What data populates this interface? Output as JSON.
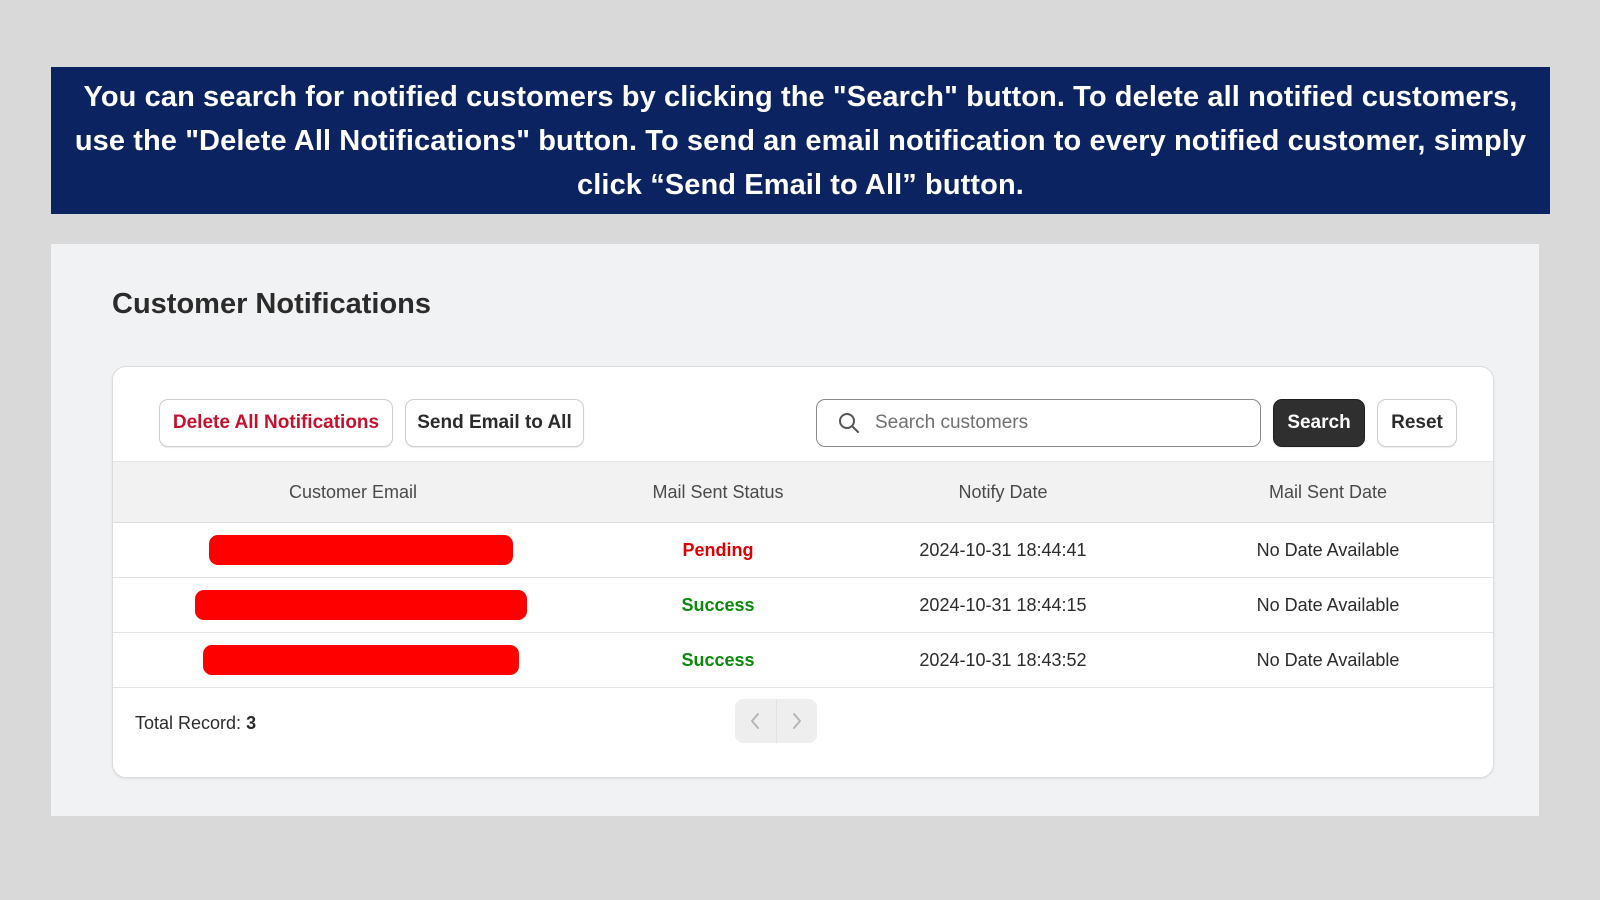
{
  "banner": {
    "text": "You can search for notified customers by clicking the \"Search\" button. To delete all notified customers, use the \"Delete All Notifications\" button. To send an email notification to every notified customer, simply click “Send Email to All” button."
  },
  "page": {
    "title": "Customer Notifications"
  },
  "toolbar": {
    "delete_all_label": "Delete All Notifications",
    "send_all_label": "Send Email to All",
    "search_placeholder": "Search customers",
    "search_value": "",
    "search_label": "Search",
    "reset_label": "Reset"
  },
  "table": {
    "columns": [
      "Customer Email",
      "Mail Sent Status",
      "Notify Date",
      "Mail Sent Date"
    ],
    "rows": [
      {
        "email": "",
        "status": "Pending",
        "notify_date": "2024-10-31 18:44:41",
        "mail_sent_date": "No Date Available"
      },
      {
        "email": "",
        "status": "Success",
        "notify_date": "2024-10-31 18:44:15",
        "mail_sent_date": "No Date Available"
      },
      {
        "email": "",
        "status": "Success",
        "notify_date": "2024-10-31 18:43:52",
        "mail_sent_date": "No Date Available"
      }
    ]
  },
  "footer": {
    "total_label": "Total Record:",
    "total_count": "3"
  },
  "colors": {
    "banner_bg": "#0b2461",
    "pending": "#e00000",
    "success": "#0a8a0a",
    "redaction": "#ff0000",
    "primary_button": "#2f2f2f"
  },
  "icons": {
    "search": "search-icon",
    "prev": "chevron-left-icon",
    "next": "chevron-right-icon"
  }
}
